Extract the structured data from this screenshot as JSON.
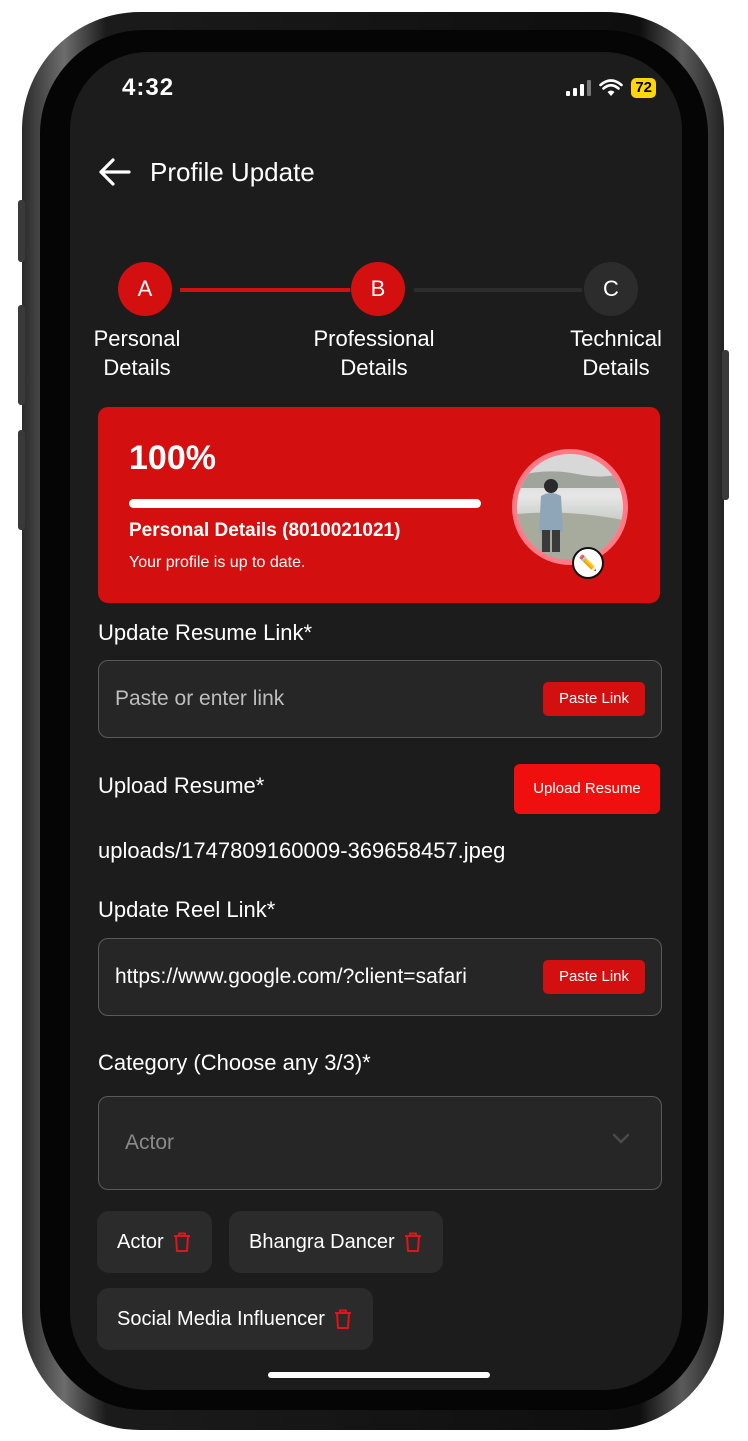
{
  "status_bar": {
    "time": "4:32",
    "battery": "72"
  },
  "header": {
    "title": "Profile Update"
  },
  "stepper": {
    "steps": [
      {
        "letter": "A",
        "line1": "Personal",
        "line2": "Details"
      },
      {
        "letter": "B",
        "line1": "Professional",
        "line2": "Details"
      },
      {
        "letter": "C",
        "line1": "Technical",
        "line2": "Details"
      }
    ]
  },
  "profile_card": {
    "percent": "100%",
    "progress": 1.0,
    "title": "Personal Details (8010021021)",
    "subtitle": "Your profile is up to date."
  },
  "resume_link": {
    "label": "Update Resume Link*",
    "placeholder": "Paste or enter link",
    "button": "Paste Link"
  },
  "upload_resume": {
    "label": "Upload Resume*",
    "button": "Upload Resume",
    "file": "uploads/1747809160009-369658457.jpeg"
  },
  "reel_link": {
    "label": "Update Reel Link*",
    "value": "https://www.google.com/?client=safari",
    "button": "Paste Link"
  },
  "category": {
    "label": "Category (Choose any 3/3)*",
    "placeholder": "Actor",
    "chips": [
      "Actor",
      "Bhangra Dancer",
      "Social Media Influencer"
    ]
  },
  "colors": {
    "accent": "#d40f10",
    "background": "#1c1c1c",
    "inactive": "#2c2c2c"
  }
}
